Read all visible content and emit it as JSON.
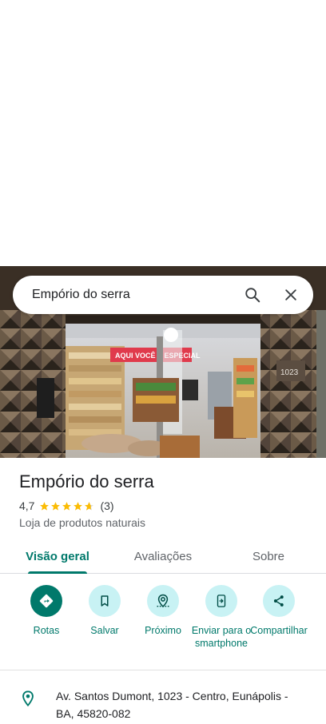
{
  "search": {
    "query": "Empório do serra"
  },
  "hero": {
    "sign_text": "AQUI VOCÊ É ESPECIAL",
    "house_number": "1023"
  },
  "place": {
    "title": "Empório do serra",
    "rating_value": "4,7",
    "rating_stars": 4.7,
    "review_count": "(3)",
    "category": "Loja de produtos naturais"
  },
  "tabs": [
    {
      "label": "Visão geral",
      "active": true
    },
    {
      "label": "Avaliações",
      "active": false
    },
    {
      "label": "Sobre",
      "active": false
    }
  ],
  "actions": [
    {
      "label": "Rotas",
      "icon": "directions-icon"
    },
    {
      "label": "Salvar",
      "icon": "bookmark-icon"
    },
    {
      "label": "Próximo",
      "icon": "nearby-icon"
    },
    {
      "label": "Enviar para o smartphone",
      "icon": "send-to-phone-icon"
    },
    {
      "label": "Compartilhar",
      "icon": "share-icon"
    }
  ],
  "address": {
    "text": "Av. Santos Dumont, 1023 - Centro, Eunápolis - BA, 45820-082"
  },
  "colors": {
    "accent": "#00796b",
    "action_bg": "#c8f2f4",
    "star": "#fbbc04"
  }
}
